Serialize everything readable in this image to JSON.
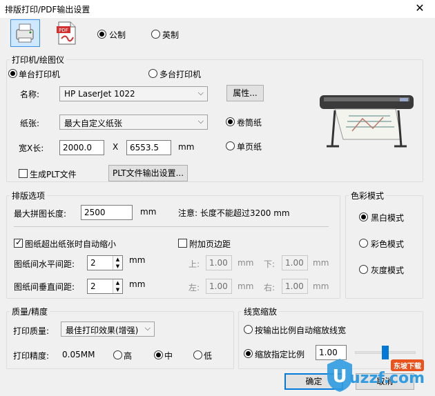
{
  "window": {
    "title": "排版打印/PDF输出设置",
    "close": "✕"
  },
  "units": {
    "metric": "公制",
    "imperial": "英制",
    "selected": "metric"
  },
  "printer": {
    "legend": "打印机/绘图仪",
    "single": "单台打印机",
    "multi": "多台打印机",
    "name_label": "名称:",
    "name_value": "HP LaserJet 1022",
    "props_button": "属性...",
    "paper_label": "纸张:",
    "paper_value": "最大自定义纸张",
    "roll": "卷筒纸",
    "sheet": "单页纸",
    "size_label": "宽X长:",
    "width": "2000.0",
    "x": "X",
    "length": "6553.5",
    "mm": "mm",
    "plt_label": "生成PLT文件",
    "plt_button": "PLT文件输出设置..."
  },
  "layout": {
    "legend": "排版选项",
    "max_len_label": "最大拼图长度:",
    "max_len_value": "2500",
    "mm": "mm",
    "note": "注意: 长度不能超过3200 mm",
    "auto_shrink": "图纸超出纸张时自动缩小",
    "margin_label": "附加页边距",
    "h_gap_label": "图纸间水平间距:",
    "h_gap_value": "2",
    "v_gap_label": "图纸间垂直间距:",
    "v_gap_value": "2",
    "top_label": "上:",
    "top_value": "1.00",
    "bottom_label": "下:",
    "bottom_value": "1.00",
    "left_label": "左:",
    "left_value": "1.00",
    "right_label": "右:",
    "right_value": "1.00"
  },
  "color": {
    "legend": "色彩模式",
    "bw": "黑白模式",
    "color": "彩色模式",
    "gray": "灰度模式"
  },
  "quality": {
    "legend": "质量/精度",
    "print_quality_label": "打印质量:",
    "print_quality_value": "最佳打印效果(增强)",
    "precision_label": "打印精度:",
    "precision_value": "0.05MM",
    "high": "高",
    "mid": "中",
    "low": "低"
  },
  "linewidth": {
    "legend": "线宽缩放",
    "auto": "按输出比例自动缩放线宽",
    "fixed": "缩放指定比例",
    "scale_value": "1.00"
  },
  "buttons": {
    "ok": "确定",
    "cancel": "取消"
  },
  "watermark": {
    "badge": "东坡下载",
    "brand": "uzzf.com"
  }
}
